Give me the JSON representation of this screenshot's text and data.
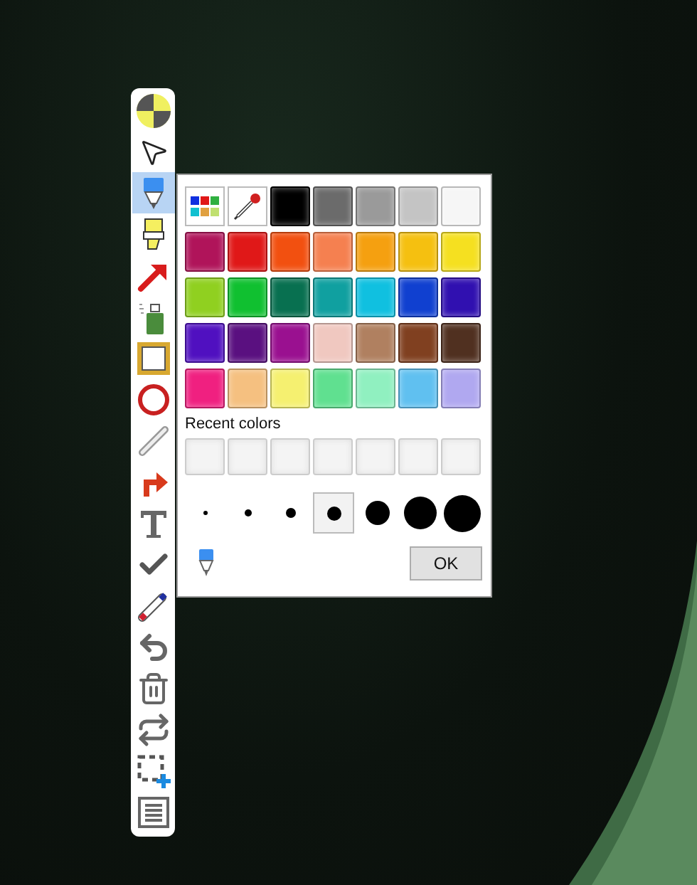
{
  "toolbar": {
    "tools": [
      {
        "kind": "color-wheel",
        "selected": false
      },
      {
        "kind": "pointer",
        "selected": false
      },
      {
        "kind": "marker",
        "selected": true
      },
      {
        "kind": "highlighter",
        "selected": false
      },
      {
        "kind": "arrow",
        "selected": false
      },
      {
        "kind": "spray",
        "selected": false
      },
      {
        "kind": "rectangle",
        "selected": false
      },
      {
        "kind": "ellipse",
        "selected": false
      },
      {
        "kind": "line",
        "selected": false
      },
      {
        "kind": "bent-arrow",
        "selected": false
      },
      {
        "kind": "text",
        "selected": false
      },
      {
        "kind": "check",
        "selected": false
      },
      {
        "kind": "eraser",
        "selected": false
      },
      {
        "kind": "undo",
        "selected": false
      },
      {
        "kind": "trash",
        "selected": false
      },
      {
        "kind": "swap",
        "selected": false
      },
      {
        "kind": "select-add",
        "selected": false
      },
      {
        "kind": "menu",
        "selected": false
      }
    ]
  },
  "color_panel": {
    "swatches": [
      {
        "kind": "palette"
      },
      {
        "kind": "eyedropper"
      },
      {
        "kind": "color",
        "color": "#000000"
      },
      {
        "kind": "color",
        "color": "#6b6b6b"
      },
      {
        "kind": "color",
        "color": "#9a9a9a"
      },
      {
        "kind": "color",
        "color": "#c4c4c4"
      },
      {
        "kind": "color",
        "color": "#f6f6f6"
      },
      {
        "kind": "color",
        "color": "#b0145a"
      },
      {
        "kind": "color",
        "color": "#e01818"
      },
      {
        "kind": "color",
        "color": "#f25010"
      },
      {
        "kind": "color",
        "color": "#f58050"
      },
      {
        "kind": "color",
        "color": "#f5a010"
      },
      {
        "kind": "color",
        "color": "#f5c010"
      },
      {
        "kind": "color",
        "color": "#f5e020"
      },
      {
        "kind": "color",
        "color": "#90d020"
      },
      {
        "kind": "color",
        "color": "#10c030"
      },
      {
        "kind": "color",
        "color": "#087050"
      },
      {
        "kind": "color",
        "color": "#10a0a0"
      },
      {
        "kind": "color",
        "color": "#10c0e0"
      },
      {
        "kind": "color",
        "color": "#1040d0"
      },
      {
        "kind": "color",
        "color": "#3010b0"
      },
      {
        "kind": "color",
        "color": "#5010c0"
      },
      {
        "kind": "color",
        "color": "#5a1080"
      },
      {
        "kind": "color",
        "color": "#9a1090"
      },
      {
        "kind": "color",
        "color": "#f0c8c0"
      },
      {
        "kind": "color",
        "color": "#b08060"
      },
      {
        "kind": "color",
        "color": "#804020"
      },
      {
        "kind": "color",
        "color": "#503020"
      },
      {
        "kind": "color",
        "color": "#f02080"
      },
      {
        "kind": "color",
        "color": "#f5c080"
      },
      {
        "kind": "color",
        "color": "#f5f070"
      },
      {
        "kind": "color",
        "color": "#60e090"
      },
      {
        "kind": "color",
        "color": "#90f0c0"
      },
      {
        "kind": "color",
        "color": "#60c0f0"
      },
      {
        "kind": "color",
        "color": "#b0a8f0"
      }
    ],
    "recent_label": "Recent colors",
    "brush_sizes": [
      {
        "selected": false
      },
      {
        "selected": false
      },
      {
        "selected": false
      },
      {
        "selected": true
      },
      {
        "selected": false
      },
      {
        "selected": false
      },
      {
        "selected": false
      }
    ],
    "ok_button": "OK"
  }
}
